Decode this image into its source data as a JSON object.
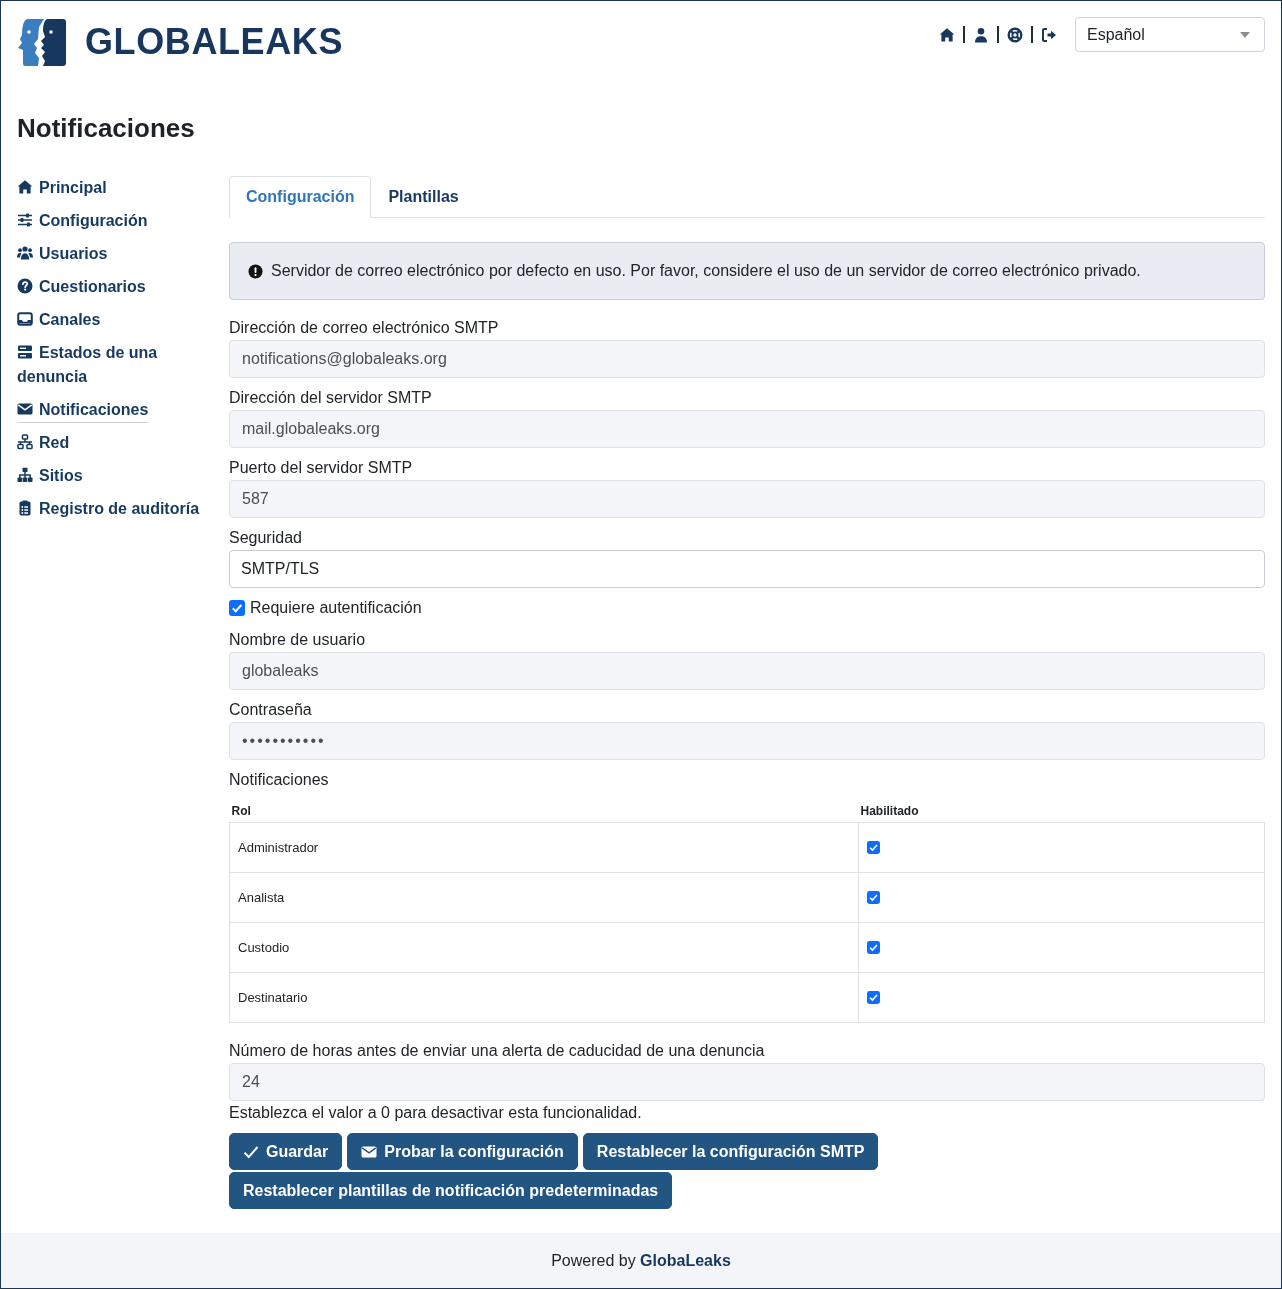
{
  "header": {
    "logo_text": "GLOBALEAKS",
    "language": "Español"
  },
  "page_title": "Notificaciones",
  "sidebar": {
    "items": [
      {
        "label": "Principal",
        "selected": false
      },
      {
        "label": "Configuración",
        "selected": false
      },
      {
        "label": "Usuarios",
        "selected": false
      },
      {
        "label": "Cuestionarios",
        "selected": false
      },
      {
        "label": "Canales",
        "selected": false
      },
      {
        "label": "Estados de una denuncia",
        "selected": false
      },
      {
        "label": "Notificaciones",
        "selected": true
      },
      {
        "label": "Red",
        "selected": false
      },
      {
        "label": "Sitios",
        "selected": false
      },
      {
        "label": "Registro de auditoría",
        "selected": false
      }
    ]
  },
  "tabs": [
    {
      "label": "Configuración",
      "selected": true
    },
    {
      "label": "Plantillas",
      "selected": false
    }
  ],
  "alert": {
    "text": "Servidor de correo electrónico por defecto en uso. Por favor, considere el uso de un servidor de correo electrónico privado."
  },
  "form": {
    "fields": [
      {
        "kind": "text",
        "label": "Dirección de correo electrónico SMTP",
        "value": "notifications@globaleaks.org"
      },
      {
        "kind": "text",
        "label": "Dirección del servidor SMTP",
        "value": "mail.globaleaks.org"
      },
      {
        "kind": "text",
        "label": "Puerto del servidor SMTP",
        "value": "587"
      },
      {
        "kind": "select",
        "label": "Seguridad",
        "value": "SMTP/TLS"
      },
      {
        "kind": "checkbox",
        "label": "Requiere autentificación",
        "checked": true
      },
      {
        "kind": "text",
        "label": "Nombre de usuario",
        "value": "globaleaks"
      },
      {
        "kind": "password",
        "label": "Contraseña",
        "value": "•••••••••••"
      },
      {
        "kind": "table",
        "label": "Notificaciones",
        "columns": [
          "Rol",
          "Habilitado"
        ],
        "rows": [
          {
            "role": "Administrador",
            "enabled": true
          },
          {
            "role": "Analista",
            "enabled": true
          },
          {
            "role": "Custodio",
            "enabled": true
          },
          {
            "role": "Destinatario",
            "enabled": true
          }
        ]
      },
      {
        "kind": "text",
        "label": "Número de horas antes de enviar una alerta de caducidad de una denuncia",
        "value": "24",
        "help": "Establezca el valor a 0 para desactivar esta funcionalidad."
      }
    ]
  },
  "buttons": [
    "Guardar",
    "Probar la configuración",
    "Restablecer la configuración SMTP",
    "Restablecer plantillas de notificación predeterminadas"
  ],
  "footer": {
    "text": "Powered by **GlobaLeaks**"
  }
}
